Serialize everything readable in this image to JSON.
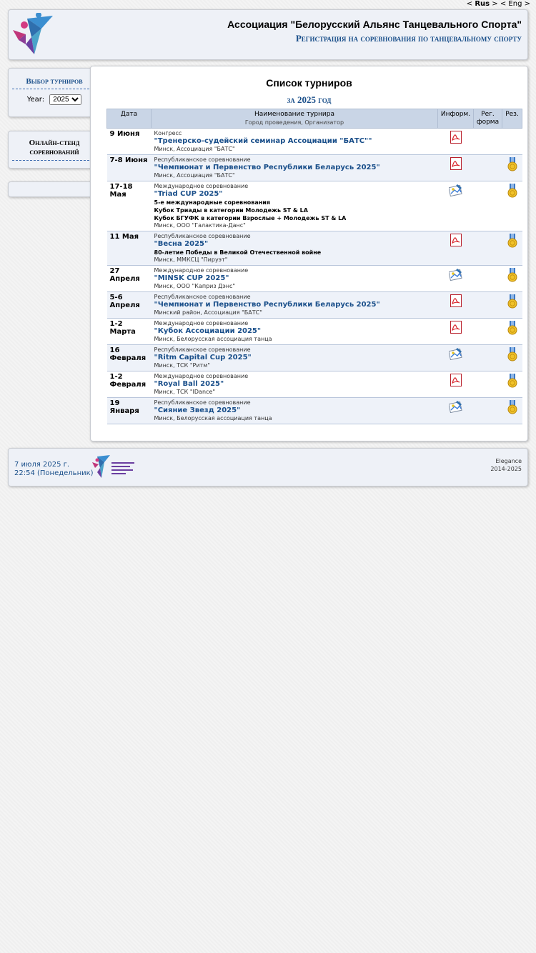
{
  "lang": {
    "open1": "< ",
    "rus": "Rus",
    "close1": " >",
    "open2": " < ",
    "eng": "Eng",
    "close2": " >"
  },
  "header": {
    "title": "Ассоциация \"Белорусский Альянс Танцевального Спорта\"",
    "subtitle": "Регистрация на соревнования по танцевальному спорту"
  },
  "sidebar": {
    "tournaments_title": "Выбор турниров",
    "year_label": "Year:",
    "year_value": "2025",
    "online_title_line1": "Онлайн-стенд",
    "online_title_line2": "соревнований"
  },
  "main": {
    "title": "Список турниров",
    "subtitle": "за 2025 год",
    "columns": {
      "date": "Дата",
      "name": "Наименование турнира",
      "name_sub": "Город проведения, Организатор",
      "info": "Информ.",
      "reg_line1": "Рег.",
      "reg_line2": "форма",
      "res": "Рез."
    },
    "rows": [
      {
        "date1": "9 Июня",
        "date2": "",
        "cat": "Конгресс",
        "name": "\"Тренерско-судейский семинар Ассоциации \"БАТС\"\"",
        "note1": "",
        "note2": "",
        "note3": "",
        "loc": "Минск, Ассоциация \"БАТС\""
      },
      {
        "date1": "7-8 Июня",
        "date2": "",
        "cat": "Республиканское соревнование",
        "name": "\"Чемпионат и Первенство Республики Беларусь 2025\"",
        "note1": "",
        "note2": "",
        "note3": "",
        "loc": "Минск, Ассоциация \"БАТС\""
      },
      {
        "date1": "17-18",
        "date2": "Мая",
        "cat": "Международное соревнование",
        "name": "\"Triad CUP 2025\"",
        "note1": "5-е международные соревнования",
        "note2": "Кубок Триады в категории Молодежь ST & LA",
        "note3": "Кубок БГУФК в категории Взрослые + Молодежь ST & LA",
        "loc": "Минск, ООО \"Галактика-Данс\""
      },
      {
        "date1": "11 Мая",
        "date2": "",
        "cat": "Республиканское соревнование",
        "name": "\"Весна 2025\"",
        "note1": "80-летие Победы в Великой Отечественной войне",
        "note2": "",
        "note3": "",
        "loc": "Минск, ММКСЦ \"Пируэт\""
      },
      {
        "date1": "27",
        "date2": "Апреля",
        "cat": "Международное соревнование",
        "name": "\"MINSK CUP 2025\"",
        "note1": "",
        "note2": "",
        "note3": "",
        "loc": "Минск, ООО \"Каприз Дэнс\""
      },
      {
        "date1": "5-6",
        "date2": "Апреля",
        "cat": "Республиканское соревнование",
        "name": "\"Чемпионат и Первенство Республики Беларусь 2025\"",
        "note1": "",
        "note2": "",
        "note3": "",
        "loc": "Минский район, Ассоциация \"БАТС\""
      },
      {
        "date1": "1-2 Марта",
        "date2": "",
        "cat": "Международное соревнование",
        "name": "\"Кубок Ассоциации 2025\"",
        "note1": "",
        "note2": "",
        "note3": "",
        "loc": "Минск, Белорусская ассоциация танца"
      },
      {
        "date1": "16",
        "date2": "Февраля",
        "cat": "Республиканское соревнование",
        "name": "\"Ritm Capital Cup 2025\"",
        "note1": "",
        "note2": "",
        "note3": "",
        "loc": "Минск, ТСК \"Ритм\""
      },
      {
        "date1": "1-2",
        "date2": "Февраля",
        "cat": "Международное соревнование",
        "name": "\"Royal Ball 2025\"",
        "note1": "",
        "note2": "",
        "note3": "",
        "loc": "Минск, ТСК \"IDance\""
      },
      {
        "date1": "19",
        "date2": "Января",
        "cat": "Республиканское соревнование",
        "name": "\"Сияние Звезд 2025\"",
        "note1": "",
        "note2": "",
        "note3": "",
        "loc": "Минск, Белорусская ассоциация танца"
      }
    ]
  },
  "icons": [
    "pdf-icon",
    "image-icon",
    "medal-icon",
    "logo-icon"
  ],
  "footer": {
    "date": "7 июля 2025 г.",
    "time": "22:54 (Понедельник)",
    "brand": "Elegance",
    "years": "2014-2025"
  },
  "colors": {
    "accent": "#1a4f8a",
    "header_bg": "#c9d5e6",
    "panel_bg": "#eef1f7"
  }
}
